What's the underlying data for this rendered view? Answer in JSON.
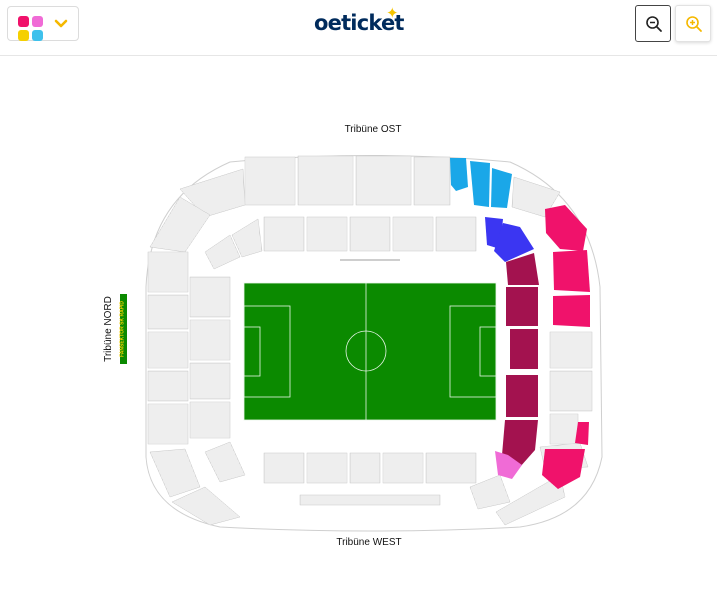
{
  "header": {
    "logo_text": "oeticket",
    "menu_icon": "app-grid-icon",
    "dropdown_icon": "chevron-down-icon",
    "zoom_out_icon": "zoom-out-icon",
    "zoom_in_icon": "zoom-in-icon"
  },
  "colors": {
    "brand_navy": "#002b5c",
    "star_yellow": "#f5c400",
    "pitch_green": "#0b8a00",
    "sector_cyan": "#1aa7e8",
    "sector_blue": "#3b36f2",
    "sector_maroon": "#a3124f",
    "sector_pink": "#f0126b",
    "sector_light_pink": "#f06bd6"
  },
  "stadium": {
    "tribune_top": "Tribüne OST",
    "tribune_bottom": "Tribüne WEST",
    "tribune_left": "Tribüne NORD",
    "fan_banner": "FANSEKTOR SK RAPID"
  }
}
